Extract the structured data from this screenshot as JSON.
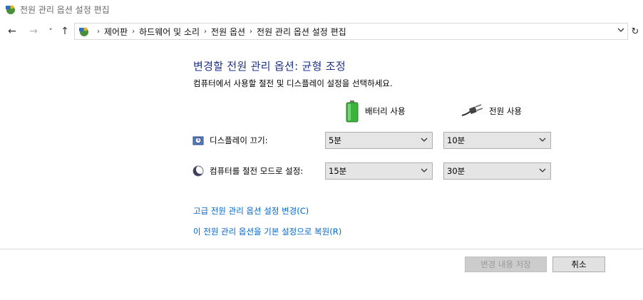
{
  "window": {
    "title": "전원 관리 옵션 설정 편집"
  },
  "nav": {
    "back": "←",
    "forward": "→",
    "recent": "˅",
    "up": "↑",
    "refresh": "↻",
    "breadcrumbs": [
      "제어판",
      "하드웨어 및 소리",
      "전원 옵션",
      "전원 관리 옵션 설정 편집"
    ]
  },
  "main": {
    "heading": "변경할 전원 관리 옵션: 균형 조정",
    "subheading": "컴퓨터에서 사용할 절전 및 디스플레이 설정을 선택하세요.",
    "columns": {
      "battery": "배터리 사용",
      "plugged": "전원 사용"
    },
    "settings": [
      {
        "label": "디스플레이 끄기:",
        "battery": "5분",
        "plugged": "10분"
      },
      {
        "label": "컴퓨터를 절전 모드로 설정:",
        "battery": "15분",
        "plugged": "30분"
      }
    ],
    "links": {
      "advanced": "고급 전원 관리 옵션 설정 변경(C)",
      "restore": "이 전원 관리 옵션을 기본 설정으로 복원(R)"
    }
  },
  "footer": {
    "save": "변경 내용 저장",
    "cancel": "취소"
  },
  "colors": {
    "heading": "#1e3287",
    "link": "#0066cc",
    "battery_green": "#3cb43c"
  }
}
